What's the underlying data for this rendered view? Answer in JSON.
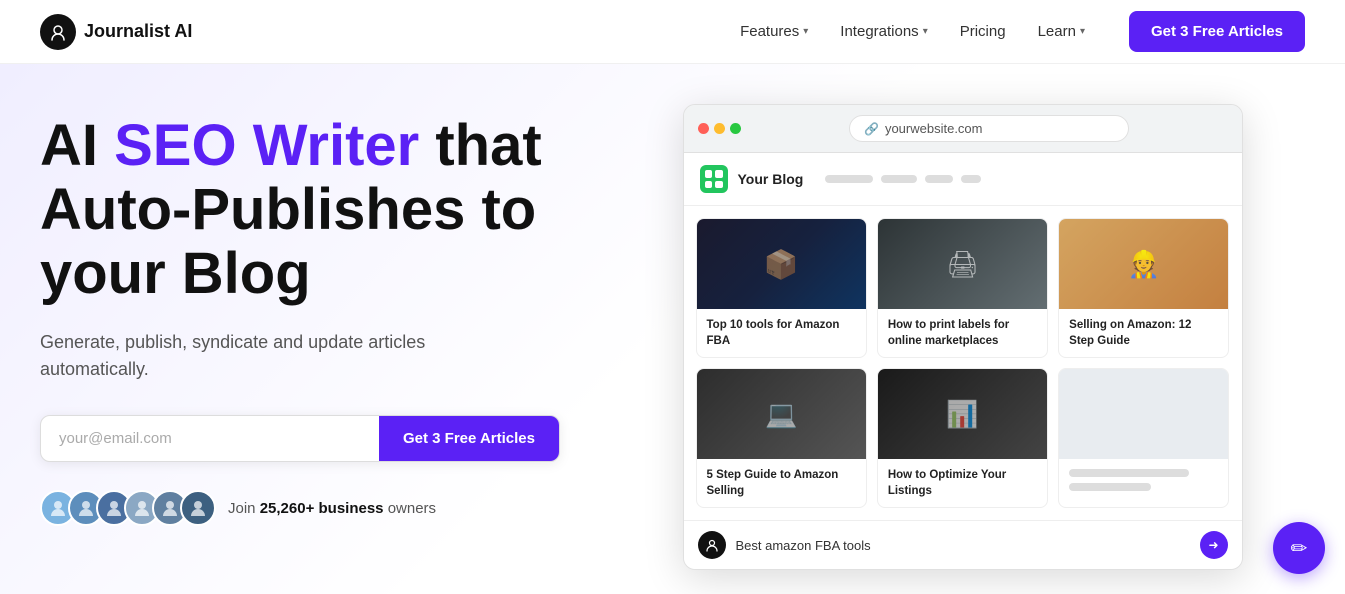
{
  "nav": {
    "logo_text": "Journalist AI",
    "links": [
      {
        "label": "Features",
        "has_dropdown": true
      },
      {
        "label": "Integrations",
        "has_dropdown": true
      },
      {
        "label": "Pricing",
        "has_dropdown": false
      },
      {
        "label": "Learn",
        "has_dropdown": true
      }
    ],
    "cta_label": "Get 3 Free Articles"
  },
  "hero": {
    "title_plain": "AI ",
    "title_highlight": "SEO Writer",
    "title_end": " that Auto-Publishes to your Blog",
    "subtitle": "Generate, publish, syndicate and update articles automatically.",
    "email_placeholder": "your@email.com",
    "cta_label": "Get 3 Free Articles",
    "social_proof_text": "Join ",
    "social_proof_bold": "25,260+ business",
    "social_proof_end": " owners"
  },
  "browser": {
    "url": "yourwebsite.com",
    "blog_name": "Your Blog",
    "cards": [
      {
        "id": 1,
        "title": "Top 10 tools for Amazon FBA",
        "img_type": "dark-boxes"
      },
      {
        "id": 2,
        "title": "How to print labels for online marketplaces",
        "img_type": "printer"
      },
      {
        "id": 3,
        "title": "Selling on Amazon: 12 Step Guide",
        "img_type": "person-warehouse"
      },
      {
        "id": 4,
        "title": "5 Step Guide to Amazon Selling",
        "img_type": "laptop-hands"
      },
      {
        "id": 5,
        "title": "How to Optimize Your Listings",
        "img_type": "laptop-dark"
      },
      {
        "id": 6,
        "title": "",
        "img_type": "placeholder"
      }
    ],
    "ai_search_text": "Best amazon FBA tools",
    "ai_search_placeholder": "Best amazon FBA tools"
  },
  "chat": {
    "icon": "✏"
  }
}
